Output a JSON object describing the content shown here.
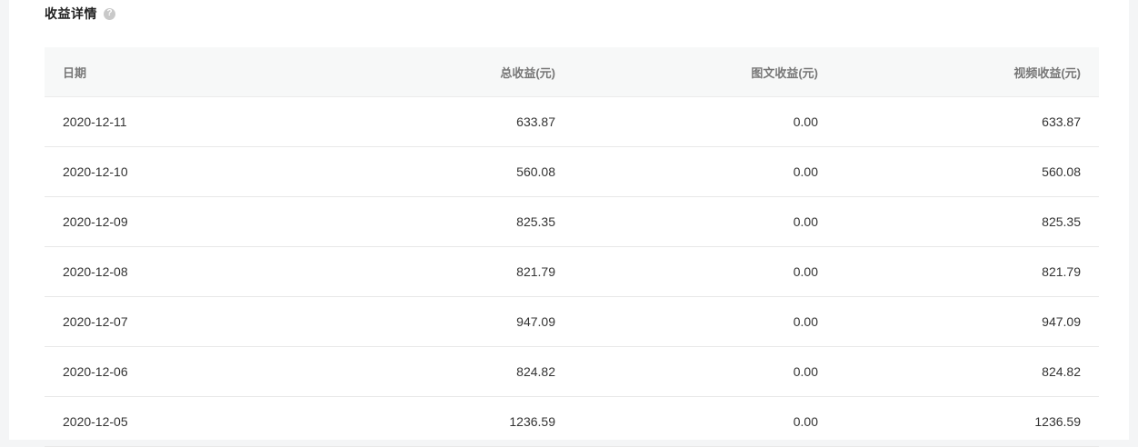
{
  "section": {
    "title": "收益详情",
    "help_glyph": "?"
  },
  "table": {
    "columns": {
      "date": "日期",
      "total": "总收益(元)",
      "article": "图文收益(元)",
      "video": "视频收益(元)"
    },
    "rows": [
      {
        "date": "2020-12-11",
        "total": "633.87",
        "article": "0.00",
        "video": "633.87"
      },
      {
        "date": "2020-12-10",
        "total": "560.08",
        "article": "0.00",
        "video": "560.08"
      },
      {
        "date": "2020-12-09",
        "total": "825.35",
        "article": "0.00",
        "video": "825.35"
      },
      {
        "date": "2020-12-08",
        "total": "821.79",
        "article": "0.00",
        "video": "821.79"
      },
      {
        "date": "2020-12-07",
        "total": "947.09",
        "article": "0.00",
        "video": "947.09"
      },
      {
        "date": "2020-12-06",
        "total": "824.82",
        "article": "0.00",
        "video": "824.82"
      },
      {
        "date": "2020-12-05",
        "total": "1236.59",
        "article": "0.00",
        "video": "1236.59"
      }
    ]
  }
}
